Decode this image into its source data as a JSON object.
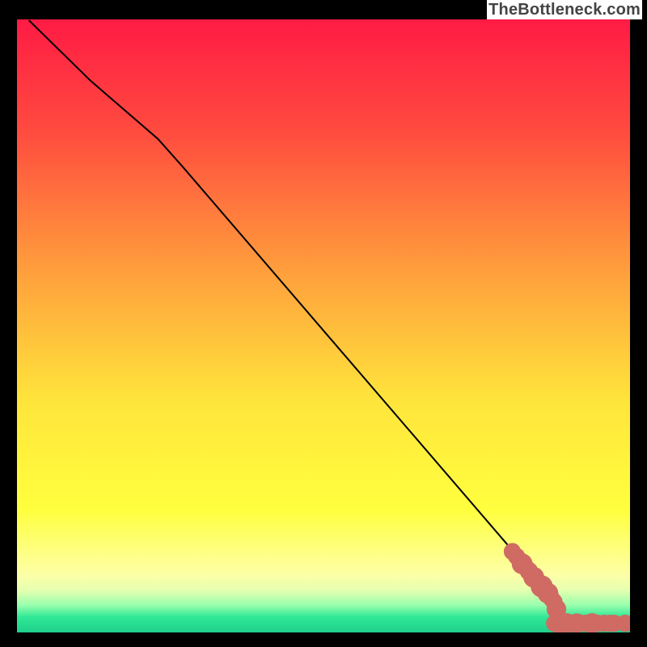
{
  "attribution": "TheBottleneck.com",
  "chart_data": {
    "type": "line",
    "title": "",
    "xlabel": "",
    "ylabel": "",
    "xlim": [
      0,
      100
    ],
    "ylim": [
      0,
      100
    ],
    "background_gradient": [
      {
        "stop": 0.0,
        "color": "#ff1b44"
      },
      {
        "stop": 0.18,
        "color": "#ff4a3f"
      },
      {
        "stop": 0.42,
        "color": "#ffa23c"
      },
      {
        "stop": 0.62,
        "color": "#ffe43b"
      },
      {
        "stop": 0.8,
        "color": "#ffff3e"
      },
      {
        "stop": 0.905,
        "color": "#fdffa6"
      },
      {
        "stop": 0.93,
        "color": "#e7ffb0"
      },
      {
        "stop": 0.955,
        "color": "#9bffad"
      },
      {
        "stop": 0.975,
        "color": "#2fe896"
      },
      {
        "stop": 1.0,
        "color": "#1fd08a"
      }
    ],
    "series": [
      {
        "name": "bottleneck-curve",
        "stroke": "#000000",
        "points": [
          {
            "x": 2.0,
            "y": 99.8
          },
          {
            "x": 12.0,
            "y": 90.0
          },
          {
            "x": 23.0,
            "y": 80.5
          },
          {
            "x": 27.0,
            "y": 76.0
          },
          {
            "x": 82.0,
            "y": 12.0
          },
          {
            "x": 87.5,
            "y": 3.5
          },
          {
            "x": 90.0,
            "y": 1.5
          },
          {
            "x": 100.0,
            "y": 1.5
          }
        ]
      }
    ],
    "marker_series": [
      {
        "name": "gpu-points",
        "color": "#cf6b63",
        "points": [
          {
            "x": 80.8,
            "y": 13.2,
            "r": 2.8
          },
          {
            "x": 81.5,
            "y": 12.4,
            "r": 2.8
          },
          {
            "x": 82.1,
            "y": 11.7,
            "r": 2.8
          },
          {
            "x": 82.4,
            "y": 11.2,
            "r": 3.4
          },
          {
            "x": 83.1,
            "y": 10.5,
            "r": 2.8
          },
          {
            "x": 83.5,
            "y": 10.0,
            "r": 3.0
          },
          {
            "x": 84.0,
            "y": 9.4,
            "r": 2.8
          },
          {
            "x": 84.3,
            "y": 9.0,
            "r": 3.4
          },
          {
            "x": 84.8,
            "y": 8.5,
            "r": 2.8
          },
          {
            "x": 85.2,
            "y": 8.0,
            "r": 2.8
          },
          {
            "x": 85.6,
            "y": 7.5,
            "r": 3.6
          },
          {
            "x": 86.0,
            "y": 7.0,
            "r": 2.8
          },
          {
            "x": 86.4,
            "y": 6.5,
            "r": 2.8
          },
          {
            "x": 86.6,
            "y": 6.4,
            "r": 3.4
          },
          {
            "x": 86.8,
            "y": 6.0,
            "r": 2.8
          },
          {
            "x": 87.2,
            "y": 5.5,
            "r": 2.8
          },
          {
            "x": 87.6,
            "y": 5.0,
            "r": 2.8
          },
          {
            "x": 88.0,
            "y": 3.8,
            "r": 3.2
          },
          {
            "x": 87.7,
            "y": 1.5,
            "r": 2.8
          },
          {
            "x": 88.3,
            "y": 1.5,
            "r": 3.2
          },
          {
            "x": 88.9,
            "y": 1.5,
            "r": 2.8
          },
          {
            "x": 89.6,
            "y": 1.5,
            "r": 3.3
          },
          {
            "x": 90.4,
            "y": 1.5,
            "r": 2.8
          },
          {
            "x": 91.3,
            "y": 1.5,
            "r": 3.2
          },
          {
            "x": 92.0,
            "y": 1.5,
            "r": 2.8
          },
          {
            "x": 92.7,
            "y": 1.5,
            "r": 2.8
          },
          {
            "x": 93.8,
            "y": 1.5,
            "r": 3.3
          },
          {
            "x": 94.7,
            "y": 1.5,
            "r": 2.8
          },
          {
            "x": 95.8,
            "y": 1.5,
            "r": 2.8
          },
          {
            "x": 96.8,
            "y": 1.5,
            "r": 2.8
          },
          {
            "x": 97.4,
            "y": 1.5,
            "r": 2.8
          },
          {
            "x": 99.2,
            "y": 1.5,
            "r": 2.8
          }
        ]
      }
    ]
  }
}
